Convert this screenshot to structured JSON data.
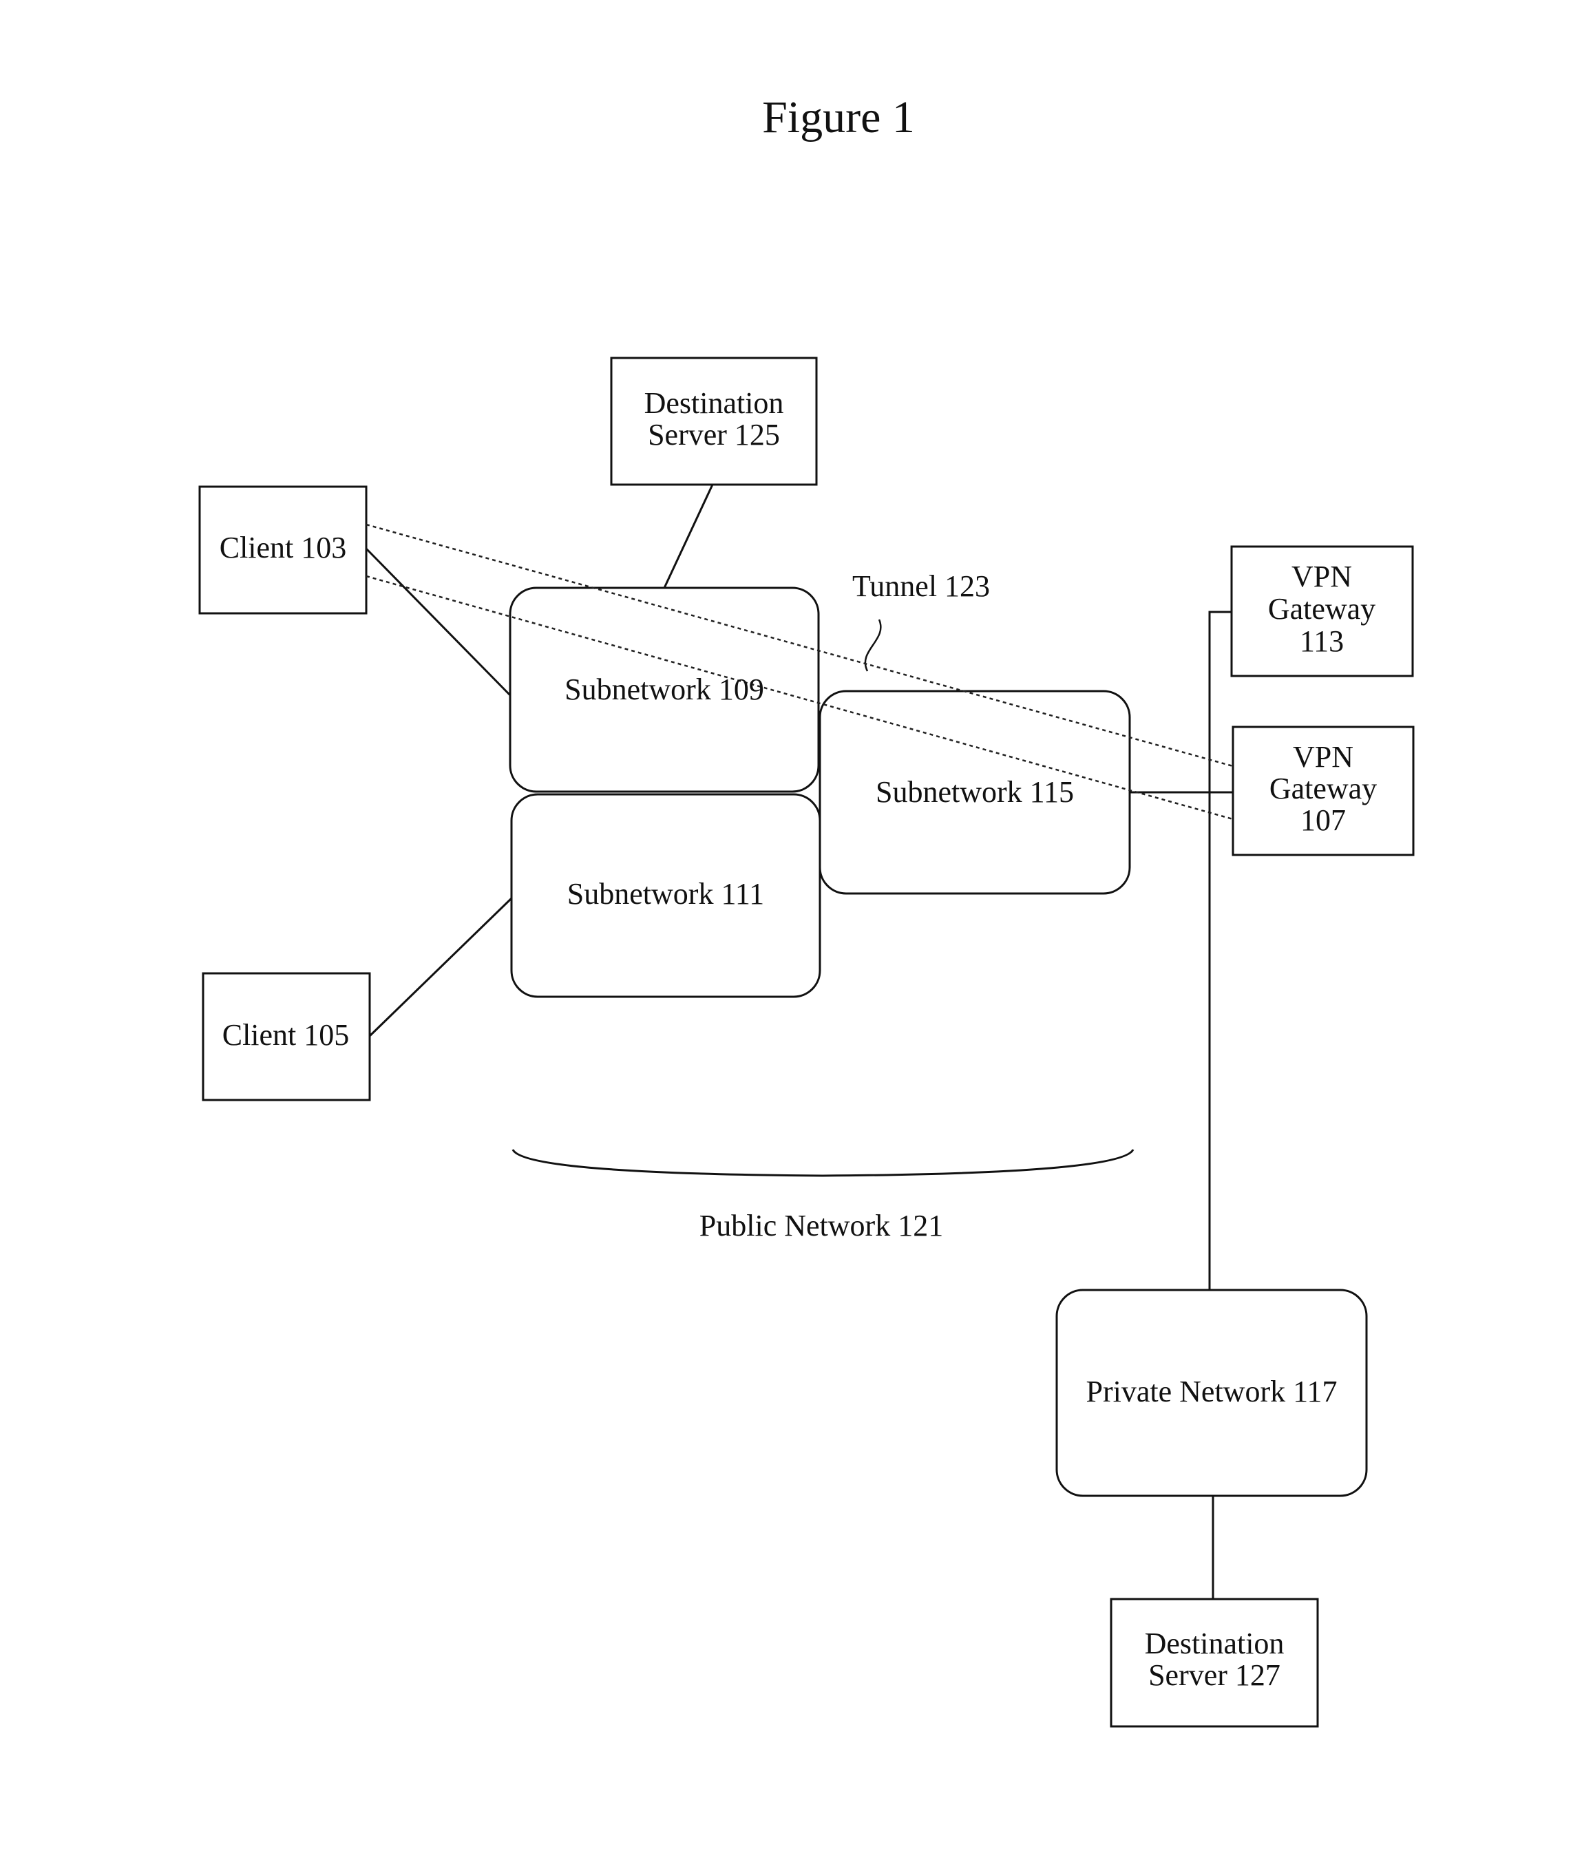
{
  "title": "Figure 1",
  "nodes": {
    "dest125": [
      "Destination",
      "Server 125"
    ],
    "client103": [
      "Client 103"
    ],
    "subnet109": [
      "Subnetwork 109"
    ],
    "subnet111": [
      "Subnetwork 111"
    ],
    "subnet115": [
      "Subnetwork 115"
    ],
    "vpn113": [
      "VPN",
      "Gateway",
      "113"
    ],
    "vpn107": [
      "VPN",
      "Gateway",
      "107"
    ],
    "client105": [
      "Client 105"
    ],
    "private117": [
      "Private Network 117"
    ],
    "dest127": [
      "Destination",
      "Server 127"
    ]
  },
  "labels": {
    "tunnel": "Tunnel 123",
    "public_network": "Public Network 121"
  }
}
